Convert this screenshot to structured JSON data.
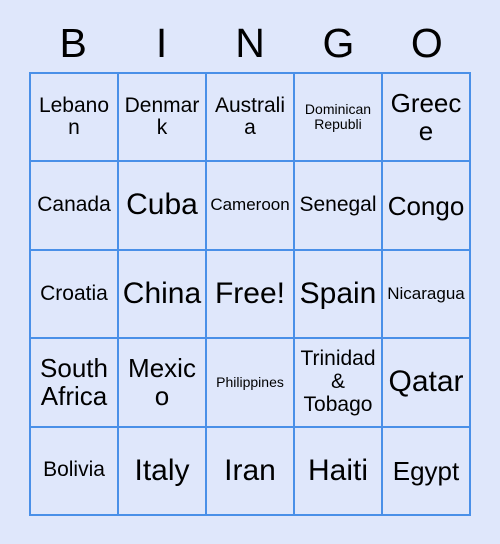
{
  "header": {
    "letters": [
      "B",
      "I",
      "N",
      "G",
      "O"
    ]
  },
  "colors": {
    "background": "#dfe7fb",
    "grid_line": "#4a90e8",
    "text": "#000000"
  },
  "grid": {
    "columns": 5,
    "rows": 5,
    "cells": [
      {
        "label": "Lebanon",
        "size": "md"
      },
      {
        "label": "Denmark",
        "size": "md"
      },
      {
        "label": "Australia",
        "size": "md"
      },
      {
        "label": "Dominican\nRepubli",
        "size": "xs"
      },
      {
        "label": "Greece",
        "size": "lg"
      },
      {
        "label": "Canada",
        "size": "md"
      },
      {
        "label": "Cuba",
        "size": "xl"
      },
      {
        "label": "Cameroon",
        "size": "sm"
      },
      {
        "label": "Senegal",
        "size": "md"
      },
      {
        "label": "Congo",
        "size": "lg"
      },
      {
        "label": "Croatia",
        "size": "md"
      },
      {
        "label": "China",
        "size": "xl"
      },
      {
        "label": "Free!",
        "size": "xl"
      },
      {
        "label": "Spain",
        "size": "xl"
      },
      {
        "label": "Nicaragua",
        "size": "sm"
      },
      {
        "label": "South\nAfrica",
        "size": "lg"
      },
      {
        "label": "Mexico",
        "size": "lg"
      },
      {
        "label": "Philippines",
        "size": "xs"
      },
      {
        "label": "Trinidad\n&\nTobago",
        "size": "md"
      },
      {
        "label": "Qatar",
        "size": "xl"
      },
      {
        "label": "Bolivia",
        "size": "md"
      },
      {
        "label": "Italy",
        "size": "xl"
      },
      {
        "label": "Iran",
        "size": "xl"
      },
      {
        "label": "Haiti",
        "size": "xl"
      },
      {
        "label": "Egypt",
        "size": "lg"
      }
    ]
  }
}
